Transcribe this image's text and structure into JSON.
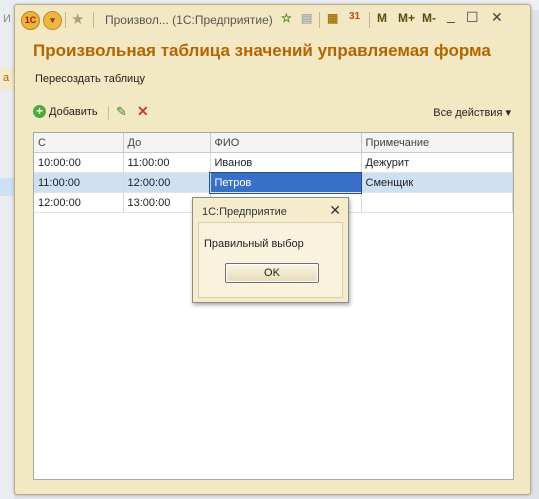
{
  "background": {
    "left_text_1": "И",
    "left_text_2": "а"
  },
  "titlebar": {
    "title": "Произвол...  (1С:Предприятие)",
    "m_label": "M",
    "m_plus_label": "M+",
    "m_minus_label": "M-",
    "minimize": "_",
    "maximize": "☐",
    "close": "✕"
  },
  "form": {
    "title": "Произвольная таблица значений управляемая форма",
    "recreate_link": "Пересоздать таблицу"
  },
  "toolbar": {
    "add_label": "Добавить",
    "all_actions_label": "Все действия ▾"
  },
  "table": {
    "columns": [
      "С",
      "До",
      "ФИО",
      "Примечание"
    ],
    "rows": [
      [
        "10:00:00",
        "11:00:00",
        "Иванов",
        "Дежурит"
      ],
      [
        "11:00:00",
        "12:00:00",
        "Петров",
        "Сменщик"
      ],
      [
        "12:00:00",
        "13:00:00",
        "",
        ""
      ]
    ]
  },
  "dialog": {
    "title": "1С:Предприятие",
    "message": "Правильный выбор",
    "ok_label": "OK"
  },
  "colors": {
    "window_bg": "#f3e8c4",
    "title_color": "#b26600",
    "selection": "#3870c8"
  }
}
